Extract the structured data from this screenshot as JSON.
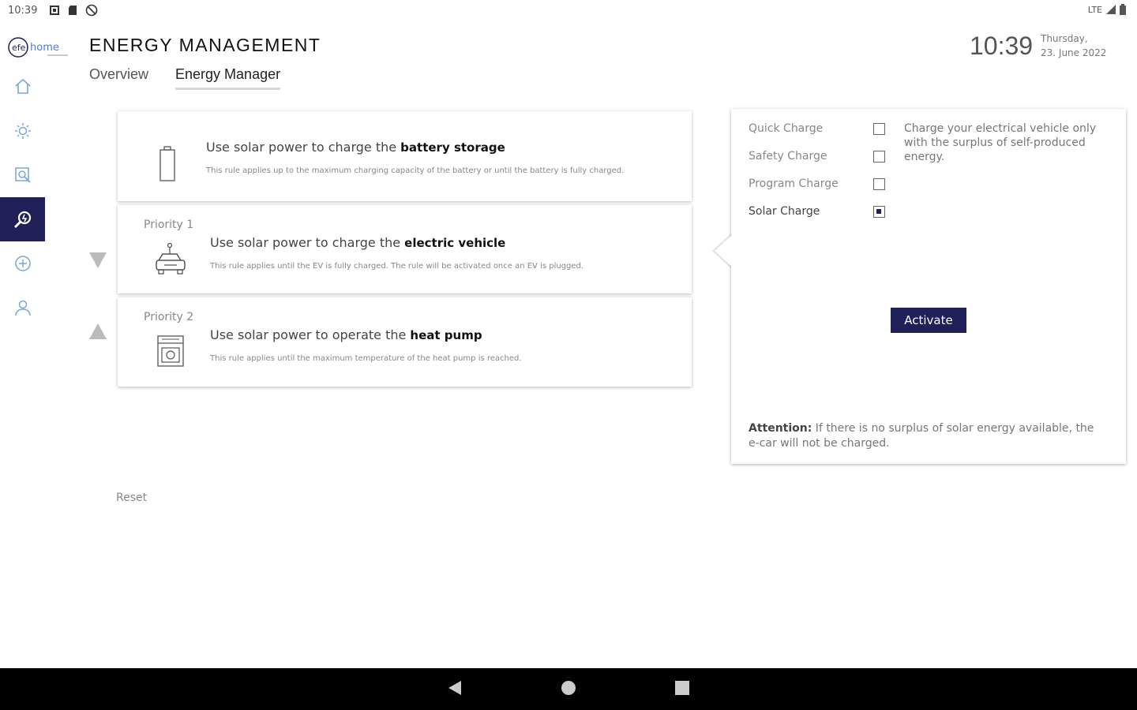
{
  "status_bar": {
    "time": "10:39",
    "network": "LTE"
  },
  "app": {
    "logo_text": "efe home",
    "page_title": "ENERGY MANAGEMENT",
    "tabs": [
      {
        "label": "Overview",
        "active": false
      },
      {
        "label": "Energy Manager",
        "active": true
      }
    ],
    "clock": "10:39",
    "date_line1": "Thursday,",
    "date_line2": "23. June 2022"
  },
  "sidebar": {
    "items": [
      {
        "icon": "home-icon"
      },
      {
        "icon": "sun-icon"
      },
      {
        "icon": "chart-search-icon"
      },
      {
        "icon": "energy-manager-icon",
        "active": true
      },
      {
        "icon": "plus-circle-icon"
      },
      {
        "icon": "user-icon"
      }
    ]
  },
  "rules": [
    {
      "priority": "",
      "icon": "battery-icon",
      "title_prefix": "Use solar power to charge the ",
      "title_bold": "battery storage",
      "description": "This rule applies up to the maximum charging capacity of the battery or until the battery is fully charged."
    },
    {
      "priority": "Priority 1",
      "icon": "car-icon",
      "title_prefix": "Use solar power to charge the ",
      "title_bold": "electric vehicle",
      "description": "This rule applies until the EV is fully charged. The rule will be activated once an EV is plugged."
    },
    {
      "priority": "Priority 2",
      "icon": "heat-pump-icon",
      "title_prefix": "Use solar power to operate the ",
      "title_bold": "heat pump",
      "description": "This rule applies until the maximum temperature of the heat pump is reached."
    }
  ],
  "panel": {
    "options": [
      {
        "label": "Quick Charge",
        "checked": false
      },
      {
        "label": "Safety Charge",
        "checked": false
      },
      {
        "label": "Program Charge",
        "checked": false
      },
      {
        "label": "Solar Charge",
        "checked": true
      }
    ],
    "description": "Charge your electrical vehicle only with the surplus of self-produced energy.",
    "activate_label": "Activate",
    "attention_label": "Attention:",
    "attention_text": " If there is no surplus of solar energy available, the e-car will not be charged."
  },
  "reset_label": "Reset",
  "colors": {
    "accent": "#1e2057",
    "logo_blue": "#4a7fd0"
  }
}
